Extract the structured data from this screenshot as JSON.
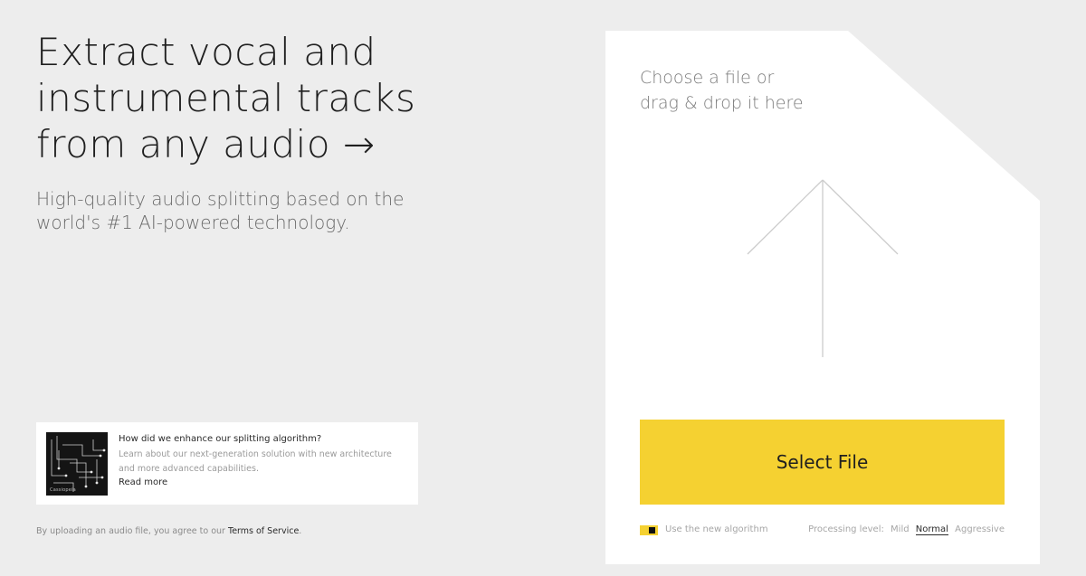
{
  "hero": {
    "headline_line1": "Extract vocal and",
    "headline_line2": "instrumental tracks",
    "headline_line3": "from any audio →",
    "subline_line1": "High-quality audio splitting based on the",
    "subline_line2": "world's #1 AI-powered technology."
  },
  "promo": {
    "thumb_caption": "Cassiopeia",
    "title": "How did we enhance our splitting algorithm?",
    "body_line1": "Learn about our next-generation solution with new architecture",
    "body_line2": "and more advanced capabilities.",
    "link": "Read more"
  },
  "terms": {
    "prefix": "By uploading an audio file, you agree to our ",
    "link": "Terms of Service",
    "suffix": "."
  },
  "upload": {
    "prompt_line1": "Choose a file or",
    "prompt_line2": "drag & drop it here",
    "arrow_icon": "upload-arrow-icon",
    "select_button": "Select File"
  },
  "options": {
    "toggle_label": "Use the new algorithm",
    "toggle_on": true,
    "level_label": "Processing level:",
    "levels": [
      "Mild",
      "Normal",
      "Aggressive"
    ],
    "selected_level": "Normal"
  },
  "colors": {
    "background": "#ededed",
    "accent": "#f5d131",
    "panel": "#ffffff"
  }
}
